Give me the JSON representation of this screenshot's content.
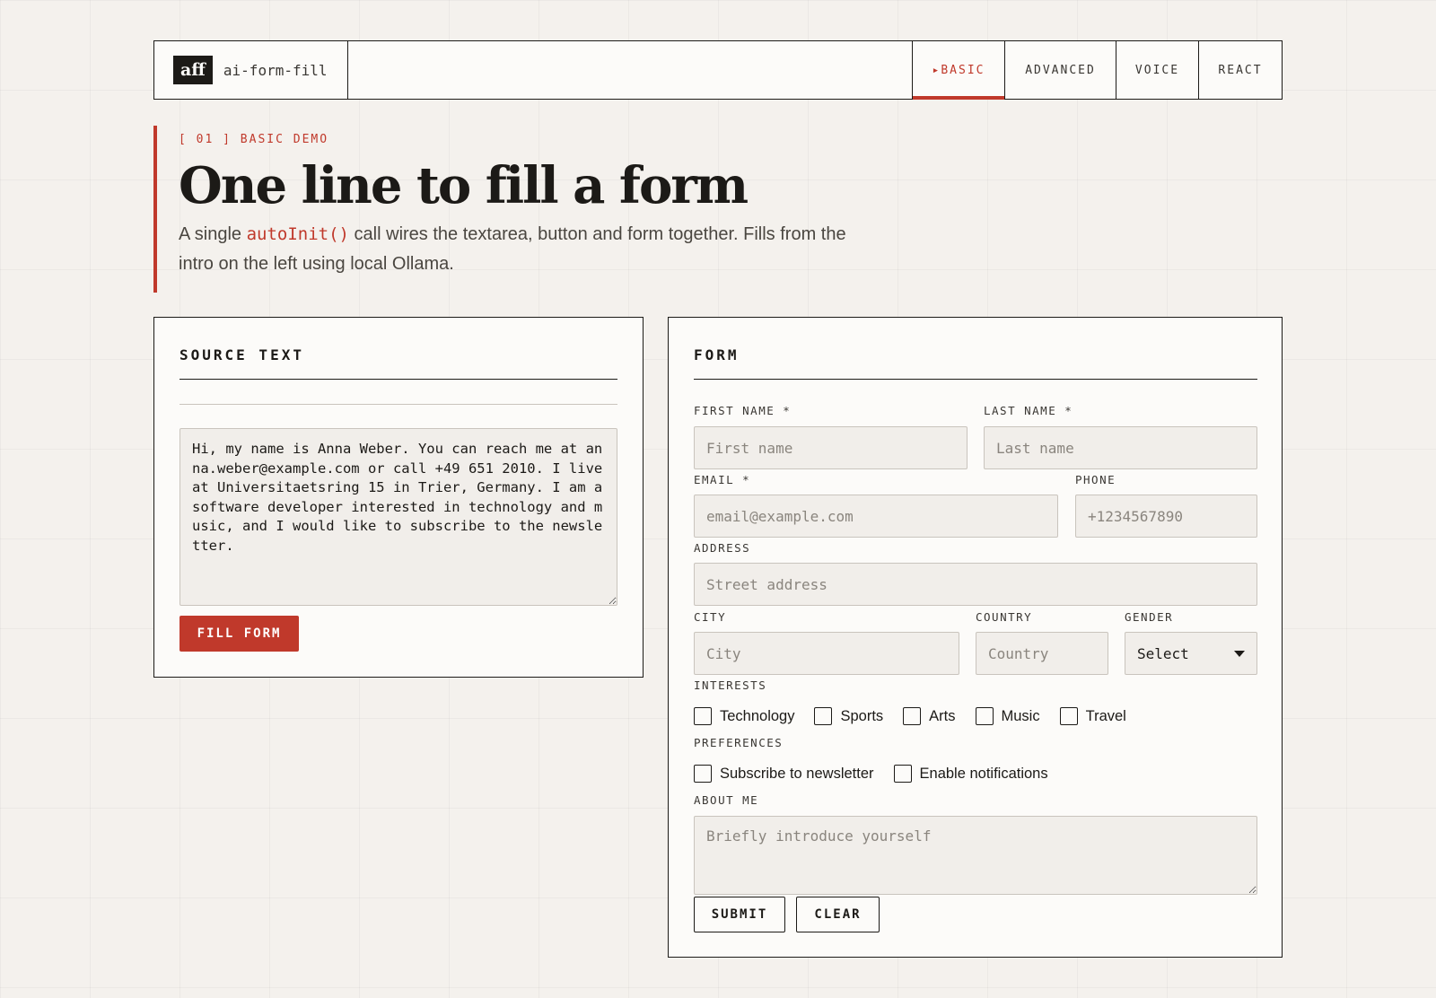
{
  "header": {
    "brand_badge": "aff",
    "brand_name": "ai-form-fill",
    "tabs": [
      {
        "label": "▸BASIC",
        "active": true
      },
      {
        "label": "ADVANCED",
        "active": false
      },
      {
        "label": "VOICE",
        "active": false
      },
      {
        "label": "REACT",
        "active": false
      }
    ]
  },
  "hero": {
    "kicker": "[ 01 ] BASIC DEMO",
    "title": "One line to fill a form",
    "lead_pre": "A single ",
    "lead_code": "autoInit()",
    "lead_post": " call wires the textarea, button and form together. Fills from the intro on the left using local Ollama."
  },
  "source": {
    "title": "SOURCE TEXT",
    "text": "Hi, my name is Anna Weber. You can reach me at anna.weber@example.com or call +49 651 2010. I live at Universitaetsring 15 in Trier, Germany. I am a software developer interested in technology and music, and I would like to subscribe to the newsletter.",
    "fill_button": "FILL FORM"
  },
  "form": {
    "title": "FORM",
    "first_name": {
      "label": "FIRST NAME *",
      "placeholder": "First name"
    },
    "last_name": {
      "label": "LAST NAME *",
      "placeholder": "Last name"
    },
    "email": {
      "label": "EMAIL *",
      "placeholder": "email@example.com"
    },
    "phone": {
      "label": "PHONE",
      "placeholder": "+1234567890"
    },
    "address": {
      "label": "ADDRESS",
      "placeholder": "Street address"
    },
    "city": {
      "label": "CITY",
      "placeholder": "City"
    },
    "country": {
      "label": "COUNTRY",
      "placeholder": "Country"
    },
    "gender": {
      "label": "GENDER",
      "value": "Select"
    },
    "interests": {
      "label": "INTERESTS",
      "options": [
        "Technology",
        "Sports",
        "Arts",
        "Music",
        "Travel"
      ]
    },
    "preferences": {
      "label": "PREFERENCES",
      "options": [
        "Subscribe to newsletter",
        "Enable notifications"
      ]
    },
    "about": {
      "label": "ABOUT ME",
      "placeholder": "Briefly introduce yourself"
    },
    "submit_label": "SUBMIT",
    "clear_label": "CLEAR"
  },
  "colors": {
    "accent": "#c0392b",
    "ink": "#1c1a17",
    "paper": "#f4f1ed",
    "panel": "#fcfbf9",
    "field": "#f1eeea"
  }
}
